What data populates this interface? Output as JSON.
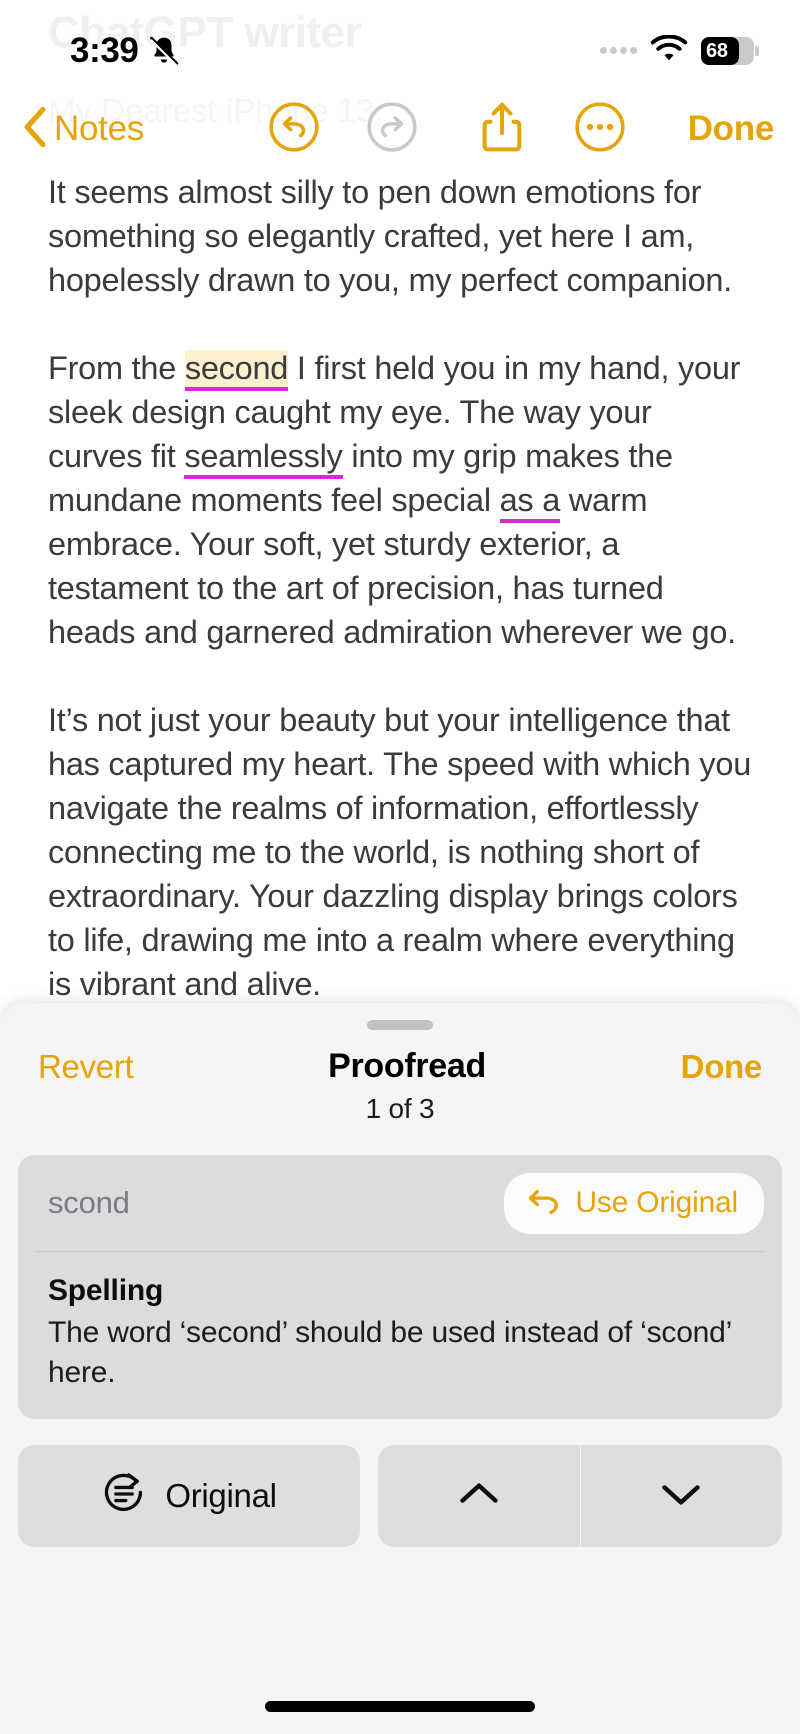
{
  "status_bar": {
    "time": "3:39",
    "silent_icon": "bell-slash-icon",
    "wifi_icon": "wifi-icon",
    "battery_percent": "68"
  },
  "ghost": {
    "title": "ChatGPT writer",
    "subtitle": "My Dearest iPhone 13,"
  },
  "navbar": {
    "back_label": "Notes",
    "undo_icon": "undo-icon",
    "redo_icon": "redo-icon",
    "share_icon": "share-icon",
    "more_icon": "more-ellipsis-icon",
    "done_label": "Done"
  },
  "note": {
    "paragraphs": [
      {
        "runs": [
          {
            "text": "It seems almost silly to pen down emotions for something so elegantly crafted, yet here I am, hopelessly drawn to you, my perfect companion.",
            "style": "plain"
          }
        ]
      },
      {
        "runs": [
          {
            "text": "From the ",
            "style": "plain"
          },
          {
            "text": "second",
            "style": "highlight-underline"
          },
          {
            "text": " I first held you in my hand, your sleek design caught my eye. The way your curves fit ",
            "style": "plain"
          },
          {
            "text": "seamlessly",
            "style": "underline"
          },
          {
            "text": " into my grip makes the mundane moments feel special ",
            "style": "plain"
          },
          {
            "text": "as a",
            "style": "underline"
          },
          {
            "text": "  warm embrace. Your soft, yet sturdy exterior, a testament to the art of precision, has turned heads and garnered admiration wherever we go.",
            "style": "plain"
          }
        ]
      },
      {
        "runs": [
          {
            "text": "It’s not just your beauty but your intelligence that has captured my heart. The speed with which you navigate the realms of information, effortlessly connecting me to the world, is nothing short of extraordinary. Your dazzling display brings colors to life, drawing me into a realm where everything is vibrant and alive.",
            "style": "plain"
          }
        ]
      }
    ]
  },
  "proofread_sheet": {
    "grabber": "sheet-grabber",
    "revert_label": "Revert",
    "title": "Proofread",
    "done_label": "Done",
    "counter": "1 of 3",
    "suggestion": {
      "original_word": "scond",
      "use_original_label": "Use Original",
      "use_original_icon": "undo-arrow-icon",
      "kind": "Spelling",
      "description": "The word ‘second’ should be used instead of ‘scond’ here."
    },
    "actions": {
      "original_label": "Original",
      "original_icon": "document-revert-icon",
      "prev_icon": "chevron-up-icon",
      "next_icon": "chevron-down-icon"
    }
  },
  "colors": {
    "accent": "#e5a50a",
    "underline": "#d62ad6",
    "highlight": "#faf0cd",
    "sheet_bg": "#f5f5f7",
    "card_bg": "#dcdcde"
  }
}
